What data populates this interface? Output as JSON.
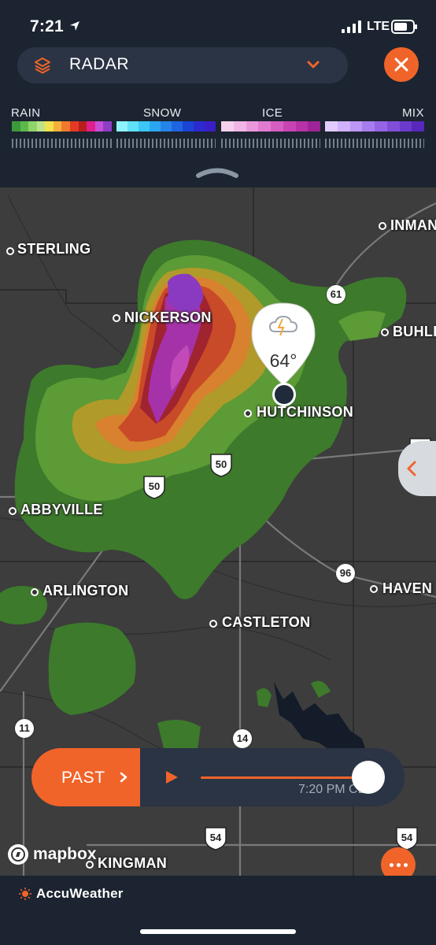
{
  "status": {
    "time": "7:21",
    "network": "LTE"
  },
  "header": {
    "layer_title": "RADAR"
  },
  "legend": {
    "rain": {
      "label": "RAIN",
      "colors": [
        "#3c9a3c",
        "#5db84a",
        "#8fd46a",
        "#bce38a",
        "#f2e14a",
        "#f5b03a",
        "#ef7a2d",
        "#e23a25",
        "#b81e1e",
        "#e01e8c",
        "#c64fd6",
        "#8e3dc7"
      ]
    },
    "snow": {
      "label": "SNOW",
      "colors": [
        "#8ef3ff",
        "#5fe0fb",
        "#3cc6f6",
        "#2aa6f0",
        "#2584e8",
        "#1f64e0",
        "#1b44d4",
        "#2a2ad0",
        "#3a1ec6"
      ]
    },
    "ice": {
      "label": "ICE",
      "colors": [
        "#f6d0ee",
        "#f1b6e6",
        "#ea98dc",
        "#e27bd0",
        "#d65dc2",
        "#c844b4",
        "#b632a6",
        "#9e2497"
      ]
    },
    "mix": {
      "label": "MIX",
      "colors": [
        "#e2ccff",
        "#cfb2fb",
        "#bc97f5",
        "#a87ded",
        "#9464e4",
        "#804ed9",
        "#6c3acc",
        "#5828bd"
      ]
    }
  },
  "map": {
    "cities": {
      "sterling": "STERLING",
      "nickerson": "NICKERSON",
      "hutchinson": "HUTCHINSON",
      "inman": "INMAN",
      "buhler": "BUHLE",
      "abbyville": "ABBYVILLE",
      "arlington": "ARLINGTON",
      "castleton": "CASTLETON",
      "haven": "HAVEN",
      "kingman": "KINGMAN"
    },
    "routes": {
      "r61": "61",
      "r50a": "50",
      "r50b": "50",
      "r50c": "50",
      "r96": "96",
      "r11": "11",
      "r14": "14",
      "r54a": "54",
      "r54b": "54"
    },
    "pin": {
      "temperature": "64°",
      "icon": "thunderstorm-icon"
    }
  },
  "timeline": {
    "mode_label": "PAST",
    "time_label": "7:20 PM CDT",
    "progress": 0.95
  },
  "attribution": {
    "mapbox": "mapbox",
    "brand": "AccuWeather"
  },
  "colors": {
    "accent": "#f0642a",
    "panel": "#1b2430",
    "pill": "#2a3444"
  }
}
